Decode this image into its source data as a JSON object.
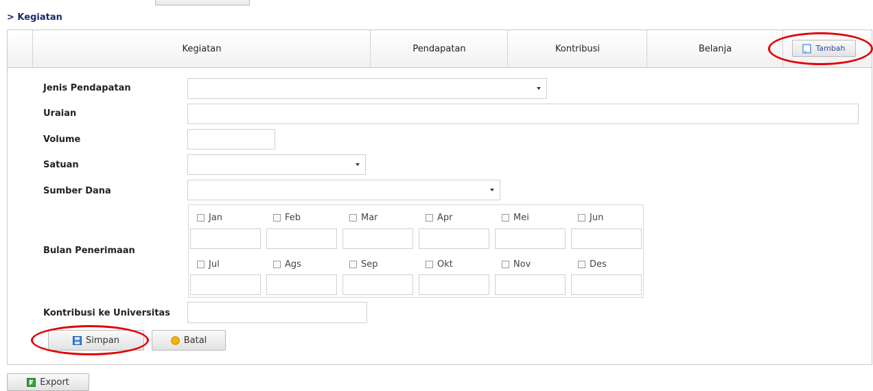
{
  "breadcrumb": "> Kegiatan",
  "tabs": {
    "kegiatan": "Kegiatan",
    "pendapatan": "Pendapatan",
    "kontribusi": "Kontribusi",
    "belanja": "Belanja",
    "tambah": "Tambah"
  },
  "form": {
    "jenis_pendapatan": {
      "label": "Jenis Pendapatan",
      "value": ""
    },
    "uraian": {
      "label": "Uraian",
      "value": ""
    },
    "volume": {
      "label": "Volume",
      "value": ""
    },
    "satuan": {
      "label": "Satuan",
      "value": ""
    },
    "sumber_dana": {
      "label": "Sumber Dana",
      "value": ""
    },
    "bulan_penerimaan": {
      "label": "Bulan Penerimaan",
      "months": [
        "Jan",
        "Feb",
        "Mar",
        "Apr",
        "Mei",
        "Jun",
        "Jul",
        "Ags",
        "Sep",
        "Okt",
        "Nov",
        "Des"
      ]
    },
    "kontribusi": {
      "label": "Kontribusi ke Universitas",
      "value": ""
    }
  },
  "actions": {
    "simpan": "Simpan",
    "batal": "Batal",
    "export": "Export"
  },
  "colors": {
    "breadcrumb": "#1a2a6e",
    "annotation": "#e30000",
    "save_icon": "#3a7fd5",
    "cancel_icon": "#f0b400",
    "export_icon": "#3aa33a"
  }
}
